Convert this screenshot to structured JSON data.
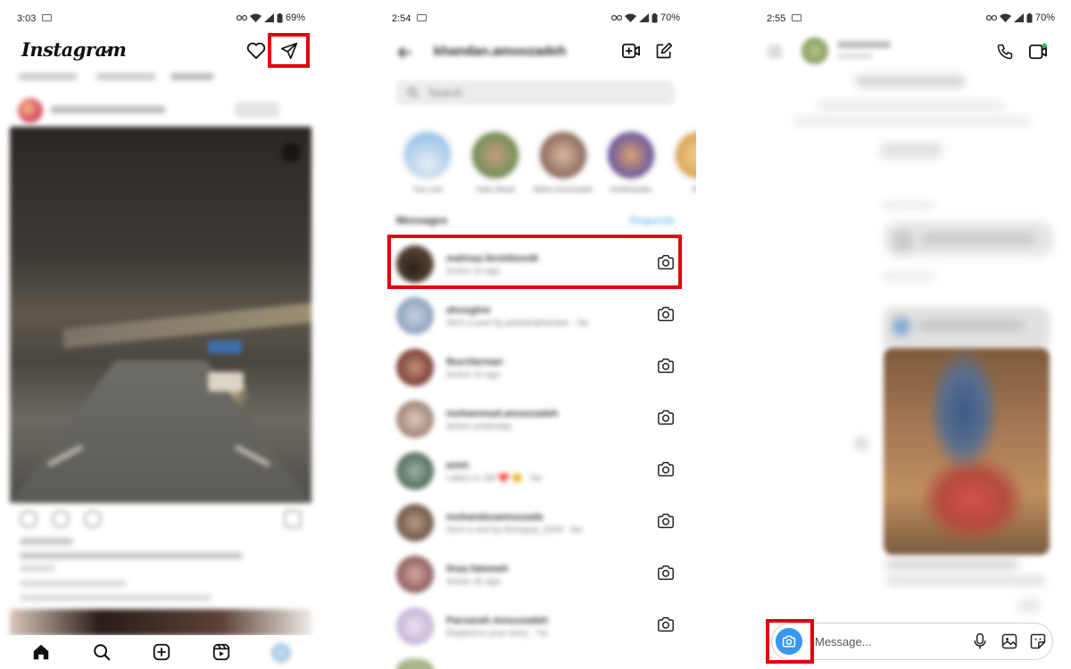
{
  "panel1": {
    "status": {
      "time": "3:03",
      "battery": "69%"
    },
    "logo": "Instagram"
  },
  "panel2": {
    "status": {
      "time": "2:54",
      "battery": "70%"
    },
    "account_name": "khandan.amoozadeh",
    "search_placeholder": "Search",
    "stories": [
      {
        "label": "Your note",
        "color": "#9fc6ea"
      },
      {
        "label": "Hafez Barati",
        "color": "#6f8f55"
      },
      {
        "label": "Mahin Amoozadeh",
        "color": "#8b6a5c"
      },
      {
        "label": "Amirkhandan",
        "color": "#6a58a0"
      },
      {
        "label": "Nim",
        "color": "#d8a55a"
      }
    ],
    "messages_header": "Messages",
    "requests_label": "Requests",
    "conversations": [
      {
        "name": "mahnaz.fereidoonik",
        "sub": "Active 1h ago",
        "color": "#5a4636"
      },
      {
        "name": "ahooghm",
        "sub": "Sent a post by pedrampharaee · 3w",
        "color": "#8ba0bd"
      },
      {
        "name": "fburzfarman",
        "sub": "Active 1h ago",
        "color": "#7a3d36"
      },
      {
        "name": "mohammad.amoozadeh",
        "sub": "Active yesterday",
        "color": "#9d8273"
      },
      {
        "name": "amin",
        "sub": "Laila's in 1M ❤️ 😊 · 5w",
        "color": "#4f6b5a"
      },
      {
        "name": "mohandesamoozade",
        "sub": "Sent a reel by thehayat_2000 · 6w",
        "color": "#6a5444"
      },
      {
        "name": "ilnaz.fatemeh",
        "sub": "Active 4h ago",
        "color": "#8a5a5a"
      },
      {
        "name": "Parvaneh Amoozadeh",
        "sub": "Replied to your story · 7w",
        "color": "#c3b3d6"
      }
    ]
  },
  "panel3": {
    "status": {
      "time": "2:55",
      "battery": "70%"
    },
    "composer_placeholder": "Message..."
  }
}
